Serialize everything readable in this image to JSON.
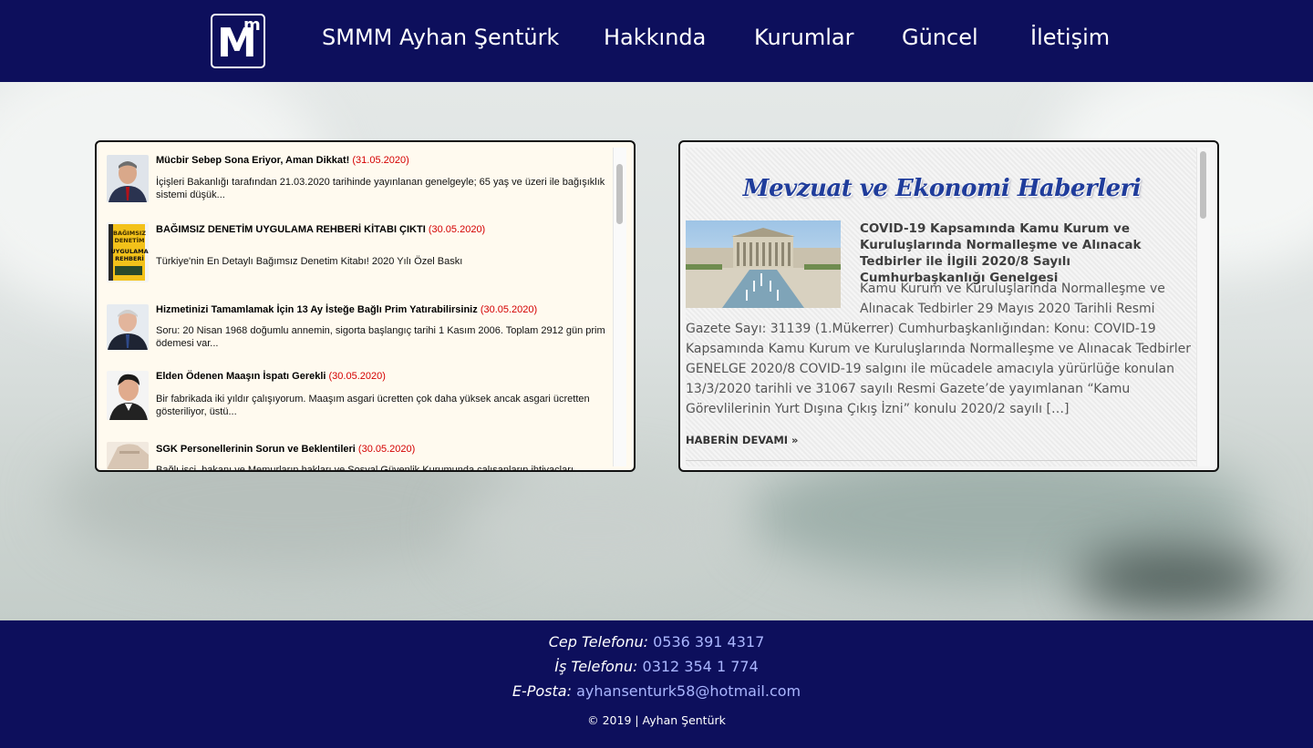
{
  "header": {
    "logo": {
      "big": "M",
      "small": "m"
    },
    "nav": [
      {
        "label": "SMMM Ayhan Şentürk"
      },
      {
        "label": "Hakkında"
      },
      {
        "label": "Kurumlar"
      },
      {
        "label": "Güncel"
      },
      {
        "label": "İletişim"
      }
    ]
  },
  "left_panel": {
    "items": [
      {
        "title": "Mücbir Sebep Sona Eriyor, Aman Dikkat!",
        "date": "(31.05.2020)",
        "summary": "İçişleri Bakanlığı tarafından 21.03.2020 tarihinde yayınlanan genelgeyle; 65 yaş ve üzeri ile bağışıklık sistemi düşük..."
      },
      {
        "title": "BAĞIMSIZ DENETİM UYGULAMA REHBERİ KİTABI ÇIKTI",
        "date": "(30.05.2020)",
        "summary": "Türkiye'nin En Detaylı Bağımsız Denetim Kitabı! 2020 Yılı Özel Baskı",
        "book_text": [
          "BAĞIMSIZ",
          "DENETİM",
          "UYGULAMA",
          "REHBERİ"
        ]
      },
      {
        "title": "Hizmetinizi Tamamlamak İçin 13 Ay İsteğe Bağlı Prim Yatırabilirsiniz",
        "date": "(30.05.2020)",
        "summary": "Soru: 20 Nisan 1968 doğumlu annemin, sigorta başlangıç tarihi 1 Kasım 2006. Toplam 2912 gün prim ödemesi var..."
      },
      {
        "title": "Elden Ödenen Maaşın İspatı Gerekli",
        "date": "(30.05.2020)",
        "summary": "Bir fabrikada iki yıldır çalışıyorum. Maaşım asgari ücretten çok daha yüksek ancak asgari ücretten gösteriliyor, üstü..."
      },
      {
        "title": "SGK Personellerinin Sorun ve Beklentileri",
        "date": "(30.05.2020)",
        "summary": "Bağlı işçi, bakanı ve Memurların hakları ve Sosyal Güvenlik Kurumunda çalışanların ihtiyaçları"
      }
    ],
    "scroll_position": 0.05
  },
  "right_panel": {
    "heading": "Mevzuat ve Ekonomi Haberleri",
    "article": {
      "title": "COVID-19 Kapsamında Kamu Kurum ve Kuruluşlarında Normalleşme ve Alınacak Tedbirler ile İlgili 2020/8 Sayılı Cumhurbaşkanlığı Genelgesi",
      "body_indented": [
        "Kamu Kurum ve Kuruluşlarında Normalleşme ve",
        "Alınacak Tedbirler 29 Mayıs 2020 Tarihli Resmi"
      ],
      "body_full": [
        "Gazete Sayı: 31139  (1.Mükerrer) Cumhurbaşkanlığından: Konu: COVID-19",
        "Kapsamında Kamu Kurum ve Kuruluşlarında Normalleşme ve Alınacak Tedbirler",
        "GENELGE 2020/8 COVID-19 salgını ile mücadele amacıyla yürürlüğe konulan",
        "13/3/2020 tarihli ve 31067 sayılı Resmi Gazete’de yayımlanan “Kamu",
        "Görevlilerinin Yurt Dışına Çıkış İzni” konulu 2020/2 sayılı […]"
      ],
      "read_more": "HABERİN DEVAMI »"
    },
    "scroll_position": 0.0
  },
  "footer": {
    "mobile_label": "Cep Telefonu:",
    "mobile_value": "0536 391 4317",
    "work_label": "İş Telefonu:",
    "work_value": "0312 354 1 774",
    "email_label": "E-Posta:",
    "email_value": "ayhansenturk58@hotmail.com",
    "copyright": "© 2019 | Ayhan Şentürk"
  },
  "colors": {
    "navy": "#0d0f5c",
    "date_red": "#d40000",
    "link_blue": "#aab6ff",
    "heading_blue": "#1f3c9b"
  }
}
